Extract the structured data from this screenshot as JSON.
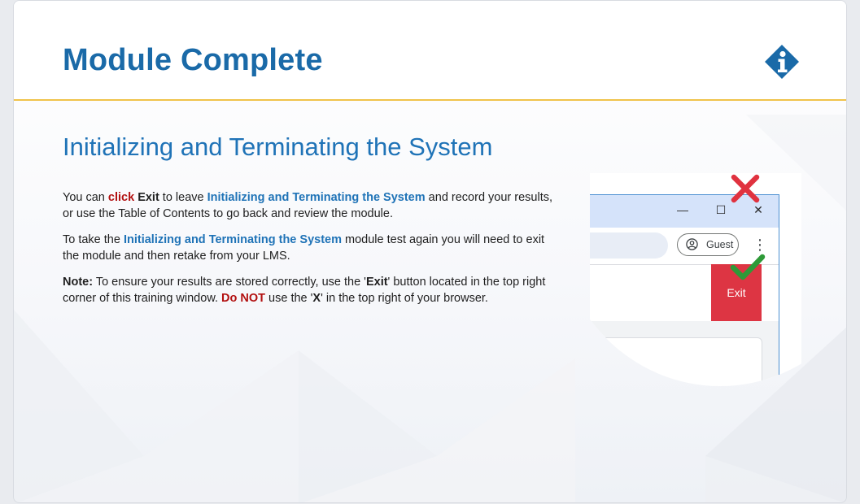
{
  "header": {
    "title": "Module Complete",
    "info_icon": "info-icon"
  },
  "section": {
    "subtitle": "Initializing and Terminating the System"
  },
  "paragraph1": {
    "t1": "You can ",
    "click": "click",
    "t2": " ",
    "exit": "Exit",
    "t3": " to leave ",
    "module": "Initializing and Terminating the System",
    "t4": " and record your results, or use the Table of Contents to go back and review the module."
  },
  "paragraph2": {
    "t1": "To take the ",
    "module": "Initializing and Terminating the System",
    "t2": " module test again you will need to exit the module and then retake from your LMS."
  },
  "paragraph3": {
    "note": "Note:",
    "t1": " To ensure your results are stored correctly, use the '",
    "exit": "Exit",
    "t2": "' button located in the top right corner of this training window. ",
    "donot": "Do NOT",
    "t3": " use the '",
    "x": "X",
    "t4": "' in the top right of your browser."
  },
  "illustration": {
    "minimize": "—",
    "maximize": "☐",
    "close": "✕",
    "guest_label": "Guest",
    "menu": "⋮",
    "exit_label": "Exit",
    "colors": {
      "exit_red": "#dd3543",
      "cross_red": "#e0323f",
      "check_green": "#2e9a38",
      "titlebar": "#d5e3fa"
    }
  },
  "colors": {
    "accent_blue": "#1a6aa8",
    "divider_gold": "#f0c34a",
    "warning_red": "#b21010"
  }
}
